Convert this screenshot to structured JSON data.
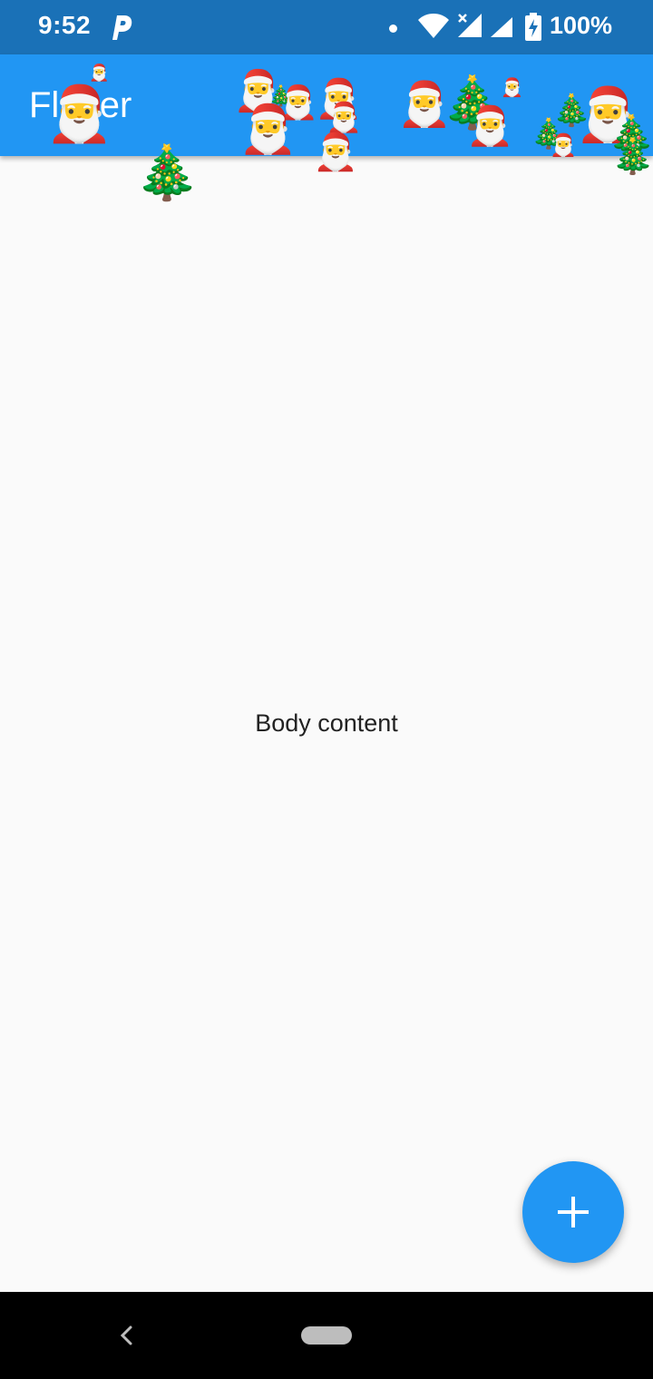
{
  "status_bar": {
    "time": "9:52",
    "battery": "100%",
    "icons": [
      "parking-app-icon",
      "notification-dot-icon",
      "wifi-icon",
      "signal-no-data-icon",
      "signal-icon",
      "battery-charging-icon"
    ]
  },
  "app_bar": {
    "title": "Flutter",
    "background": "#2196f3"
  },
  "body": {
    "text": "Body content"
  },
  "fab": {
    "icon": "plus-icon",
    "background": "#2196f3"
  },
  "nav_bar": {
    "icons": [
      "back-icon",
      "home-pill-icon"
    ]
  },
  "decorations": {
    "santa_glyph": "🎅",
    "tree_glyph": "🎄"
  }
}
